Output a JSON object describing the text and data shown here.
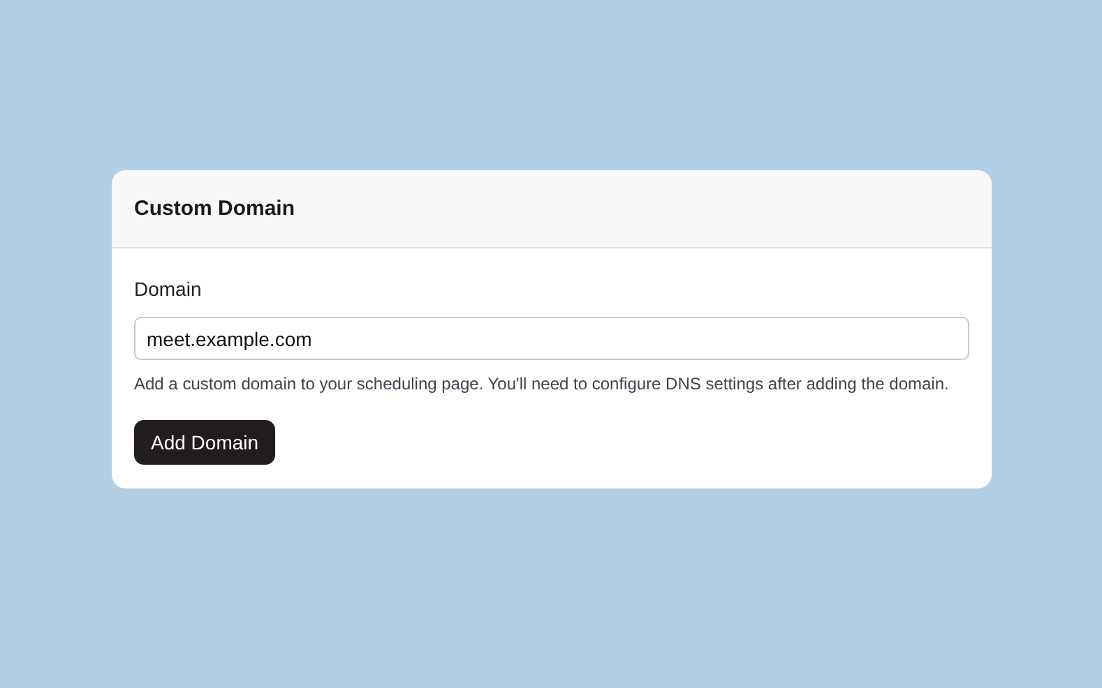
{
  "card": {
    "title": "Custom Domain"
  },
  "field": {
    "label": "Domain",
    "value": "meet.example.com",
    "help": "Add a custom domain to your scheduling page. You'll need to configure DNS settings after adding the domain."
  },
  "button": {
    "label": "Add Domain"
  }
}
